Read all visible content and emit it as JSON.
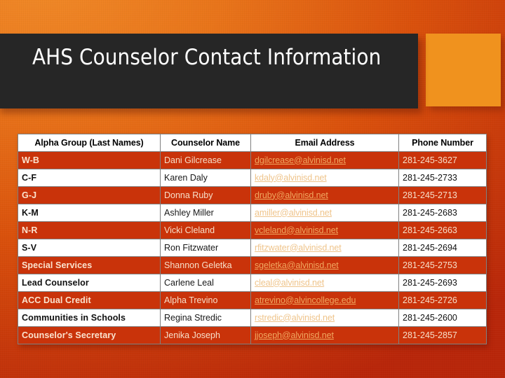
{
  "slide": {
    "title": "AHS Counselor Contact Information",
    "accent_color": "#F0921E",
    "title_block_color": "#262626",
    "background_colors": [
      "#F08A28",
      "#D9500C",
      "#B8260A"
    ],
    "row_highlight_color": "#C9330A"
  },
  "table": {
    "headers": {
      "alpha": "Alpha Group (Last Names)",
      "name": "Counselor Name",
      "email": "Email Address",
      "phone": "Phone Number"
    },
    "rows": [
      {
        "alpha": "W-B",
        "name": "Dani Gilcrease",
        "email": "dgilcrease@alvinisd.net",
        "phone": "281-245-3627"
      },
      {
        "alpha": "C-F",
        "name": "Karen Daly",
        "email": "kdaly@alvinisd.net",
        "phone": "281-245-2733"
      },
      {
        "alpha": "G-J",
        "name": "Donna Ruby",
        "email": "druby@alvinisd.net",
        "phone": "281-245-2713"
      },
      {
        "alpha": "K-M",
        "name": "Ashley Miller",
        "email": "amiller@alvinisd.net",
        "phone": "281-245-2683"
      },
      {
        "alpha": "N-R",
        "name": "Vicki Cleland",
        "email": "vcleland@alvinisd.net",
        "phone": "281-245-2663"
      },
      {
        "alpha": "S-V",
        "name": "Ron Fitzwater",
        "email": "rfitzwater@alvinisd.net",
        "phone": "281-245-2694"
      },
      {
        "alpha": "Special Services",
        "name": "Shannon Geletka",
        "email": "sgeletka@alvinisd.net",
        "phone": "281-245-2753"
      },
      {
        "alpha": "Lead Counselor",
        "name": "Carlene Leal",
        "email": "cleal@alvinisd.net",
        "phone": "281-245-2693"
      },
      {
        "alpha": "ACC Dual Credit",
        "name": "Alpha Trevino",
        "email": "atrevino@alvincollege.edu",
        "phone": "281-245-2726"
      },
      {
        "alpha": "Communities in Schools",
        "name": "Regina Stredic",
        "email": "rstredic@alvinisd.net",
        "phone": "281-245-2600"
      },
      {
        "alpha": "Counselor's Secretary",
        "name": "Jenika Joseph",
        "email": "jjoseph@alvinisd.net",
        "phone": "281-245-2857"
      }
    ]
  }
}
